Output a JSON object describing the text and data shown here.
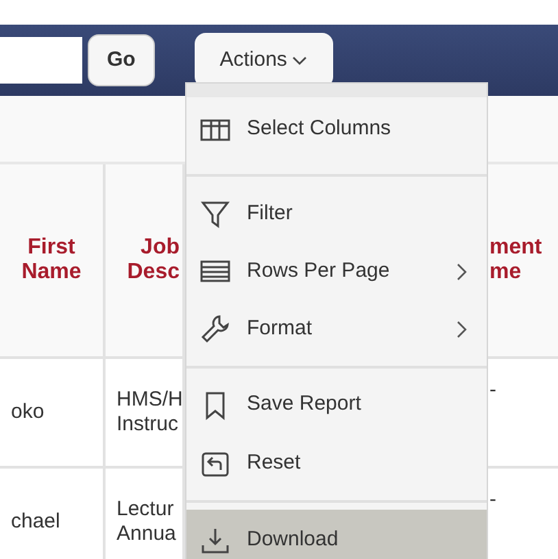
{
  "toolbar": {
    "go_button": "Go",
    "actions_button": "Actions"
  },
  "table": {
    "columns": [
      "First Name",
      "Job Desc",
      "ment me"
    ],
    "rows": [
      {
        "cells": [
          "oko",
          "HMS/H Instruc",
          "-"
        ]
      },
      {
        "cells": [
          "chael",
          "Lectur Annua",
          "-"
        ]
      }
    ]
  },
  "actions_menu": {
    "groups": [
      [
        {
          "label": "Select Columns",
          "submenu": false,
          "highlighted": false
        }
      ],
      [
        {
          "label": "Filter",
          "submenu": false,
          "highlighted": false
        },
        {
          "label": "Rows Per Page",
          "submenu": true,
          "highlighted": false
        },
        {
          "label": "Format",
          "submenu": true,
          "highlighted": false
        }
      ],
      [
        {
          "label": "Save Report",
          "submenu": false,
          "highlighted": false
        },
        {
          "label": "Reset",
          "submenu": false,
          "highlighted": false
        }
      ],
      [
        {
          "label": "Download",
          "submenu": false,
          "highlighted": true
        }
      ]
    ]
  }
}
